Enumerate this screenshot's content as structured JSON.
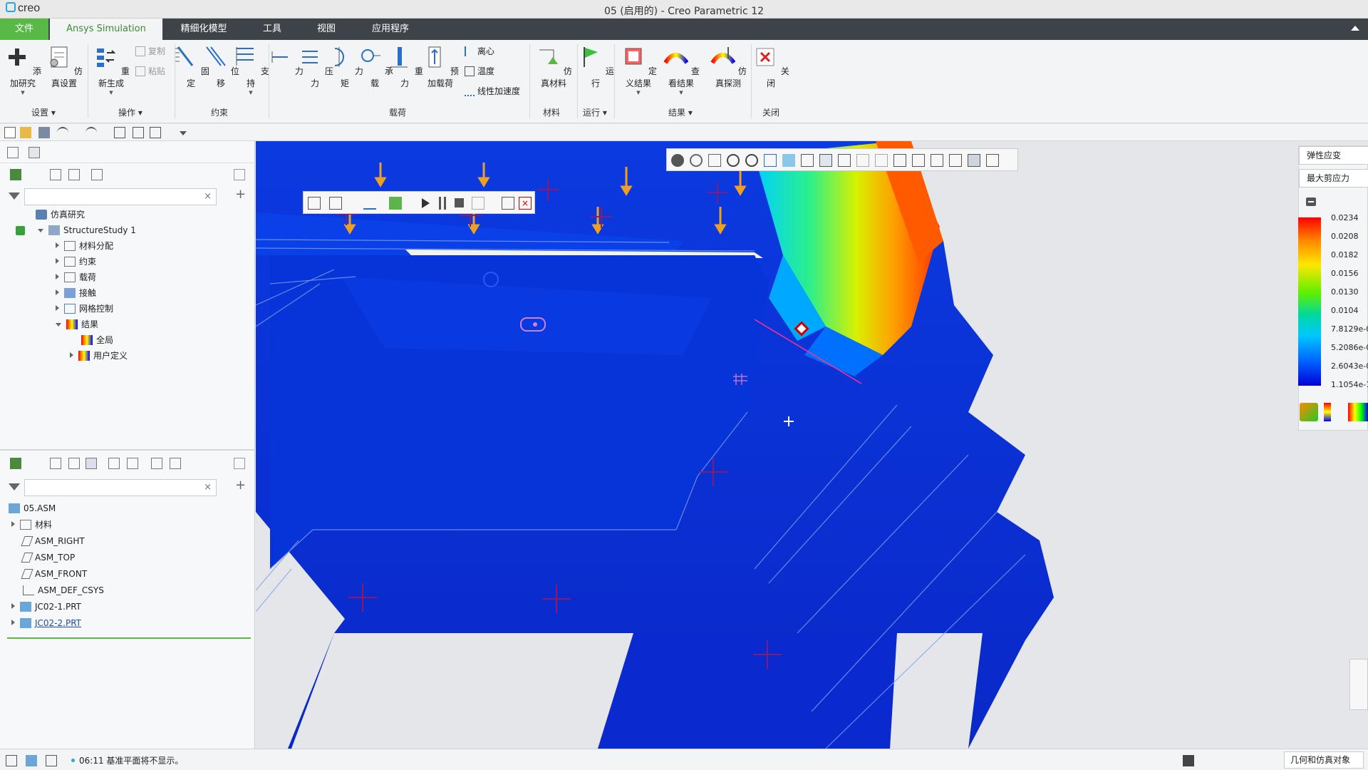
{
  "window": {
    "app_logo": "creo",
    "title": "05 (启用的) - Creo Parametric 12"
  },
  "menu": {
    "file": "文件",
    "tabs": [
      "Ansys Simulation",
      "精细化模型",
      "工具",
      "视图",
      "应用程序"
    ]
  },
  "ribbon": {
    "buttons": {
      "add_study": "添加研究",
      "sim_setup": "仿真设置",
      "regenerate": "重新生成",
      "fixed": "固定",
      "displacement": "位移",
      "support": "支持",
      "force": "力",
      "pressure": "压力",
      "moment": "力矩",
      "bearing": "承载",
      "gravity": "重力",
      "preload": "预加载荷",
      "sim_material": "仿真材料",
      "run": "运行",
      "define_result": "定义结果",
      "view_result": "查看结果",
      "sim_probe": "仿真探测",
      "close": "关闭"
    },
    "small": {
      "copy": "复制",
      "paste": "粘贴",
      "centrifugal": "离心",
      "temperature": "温度",
      "linear_accel": "线性加速度"
    },
    "groups": {
      "setup": "设置",
      "operation": "操作",
      "constraint": "约束",
      "load": "载荷",
      "material": "材料",
      "run": "运行",
      "result": "结果",
      "close": "关闭"
    }
  },
  "sim_tree": {
    "root": "仿真研究",
    "study": "StructureStudy 1",
    "items": [
      "材料分配",
      "约束",
      "载荷",
      "接触",
      "网格控制",
      "结果"
    ],
    "results": [
      "全局",
      "用户定义"
    ]
  },
  "model_tree": {
    "root": "05.ASM",
    "items": [
      "材料",
      "ASM_RIGHT",
      "ASM_TOP",
      "ASM_FRONT",
      "ASM_DEF_CSYS",
      "JC02-1.PRT",
      "JC02-2.PRT"
    ]
  },
  "legend": {
    "result_type": "弹性应变",
    "component": "最大剪应力",
    "ticks": [
      "0.0234",
      "0.0208",
      "0.0182",
      "0.0156",
      "0.0130",
      "0.0104",
      "7.8129e-0",
      "5.2086e-0",
      "2.6043e-0",
      "1.1054e-1"
    ]
  },
  "status": {
    "message": "06:11 基准平面将不显示。",
    "filter": "几何和仿真对象"
  },
  "colors": {
    "accent": "#58b947",
    "menubar": "#3e4249",
    "mesh_blue": "#0a2fd6",
    "arrow_orange": "#f0a020"
  }
}
